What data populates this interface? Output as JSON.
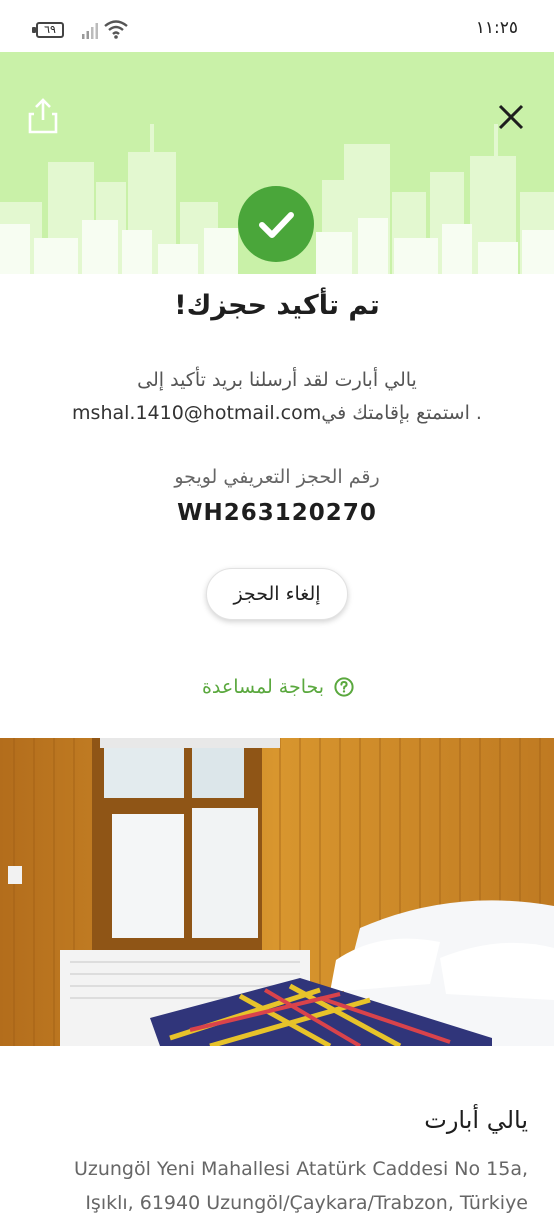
{
  "status_bar": {
    "battery": "٦٩",
    "time": "١١:٢٥"
  },
  "hero": {
    "share_icon": "share-icon",
    "close_icon": "close-icon",
    "check_icon": "check-icon",
    "background_color": "#c9f1a8",
    "accent_color": "#4aa63a"
  },
  "confirmation": {
    "title": "تم تأكيد حجزك!",
    "message_line1": "يالي أبارت لقد أرسلنا بريد تأكيد إلى",
    "message_email": "mshal.1410@hotmail.com",
    "message_line2": ". استمتع بإقامتك في",
    "reference_label": "رقم الحجز التعريفي لويجو",
    "reference_number": "WH263120270"
  },
  "actions": {
    "cancel_label": "إلغاء الحجز",
    "help_label": "بحاجة لمساعدة",
    "help_icon": "question-circle-icon"
  },
  "property": {
    "name": "يالي أبارت",
    "address_line1": "Uzungöl Yeni Mahallesi Atatürk Caddesi No 15a,",
    "address_line2": "Işıklı, 61940 Uzungöl/Çaykara/Trabzon, Türkiye"
  }
}
